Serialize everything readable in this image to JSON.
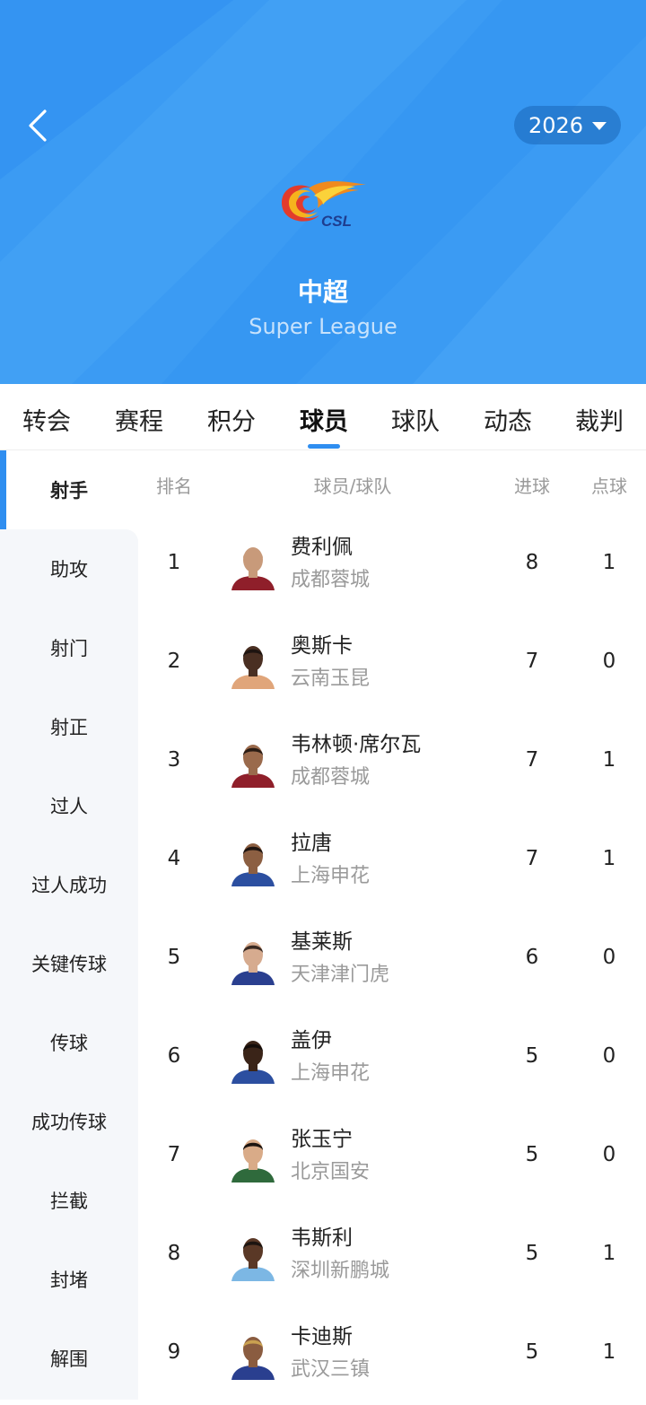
{
  "header": {
    "season": "2026",
    "league_name": "中超",
    "league_name_en": "Super League",
    "logo_text": "CSL"
  },
  "tabs": [
    {
      "label": "转会"
    },
    {
      "label": "赛程"
    },
    {
      "label": "积分"
    },
    {
      "label": "球员",
      "active": true
    },
    {
      "label": "球队"
    },
    {
      "label": "动态"
    },
    {
      "label": "裁判"
    }
  ],
  "sidebar": {
    "items": [
      {
        "label": "射手",
        "active": true
      },
      {
        "label": "助攻"
      },
      {
        "label": "射门"
      },
      {
        "label": "射正"
      },
      {
        "label": "过人"
      },
      {
        "label": "过人成功"
      },
      {
        "label": "关键传球"
      },
      {
        "label": "传球"
      },
      {
        "label": "成功传球"
      },
      {
        "label": "拦截"
      },
      {
        "label": "封堵"
      },
      {
        "label": "解围"
      }
    ]
  },
  "table": {
    "headers": {
      "rank": "排名",
      "player": "球员/球队",
      "goals": "进球",
      "penalties": "点球"
    },
    "rows": [
      {
        "rank": "1",
        "name": "费利佩",
        "team": "成都蓉城",
        "goals": "8",
        "penalties": "1",
        "kit": "#8f1f2a",
        "skin": "#c89a7a",
        "hair": "#c89a7a"
      },
      {
        "rank": "2",
        "name": "奥斯卡",
        "team": "云南玉昆",
        "goals": "7",
        "penalties": "0",
        "kit": "#e0a57a",
        "skin": "#4a2f22",
        "hair": "#1e1410"
      },
      {
        "rank": "3",
        "name": "韦林顿·席尔瓦",
        "team": "成都蓉城",
        "goals": "7",
        "penalties": "1",
        "kit": "#8f1f2a",
        "skin": "#9a6a4c",
        "hair": "#2a1c14"
      },
      {
        "rank": "4",
        "name": "拉唐",
        "team": "上海申花",
        "goals": "7",
        "penalties": "1",
        "kit": "#2c4fa0",
        "skin": "#8c5f42",
        "hair": "#1e1410"
      },
      {
        "rank": "5",
        "name": "基莱斯",
        "team": "天津津门虎",
        "goals": "6",
        "penalties": "0",
        "kit": "#2a3f8f",
        "skin": "#d6ab8f",
        "hair": "#3a2a22"
      },
      {
        "rank": "6",
        "name": "盖伊",
        "team": "上海申花",
        "goals": "5",
        "penalties": "0",
        "kit": "#2c4fa0",
        "skin": "#3a2418",
        "hair": "#140d0a"
      },
      {
        "rank": "7",
        "name": "张玉宁",
        "team": "北京国安",
        "goals": "5",
        "penalties": "0",
        "kit": "#2f6a3c",
        "skin": "#d9ab88",
        "hair": "#1c1410"
      },
      {
        "rank": "8",
        "name": "韦斯利",
        "team": "深圳新鹏城",
        "goals": "5",
        "penalties": "1",
        "kit": "#7cb7e4",
        "skin": "#5a3826",
        "hair": "#1c1410"
      },
      {
        "rank": "9",
        "name": "卡迪斯",
        "team": "武汉三镇",
        "goals": "5",
        "penalties": "1",
        "kit": "#2a3f8f",
        "skin": "#8a5c40",
        "hair": "#c9a050"
      }
    ]
  }
}
